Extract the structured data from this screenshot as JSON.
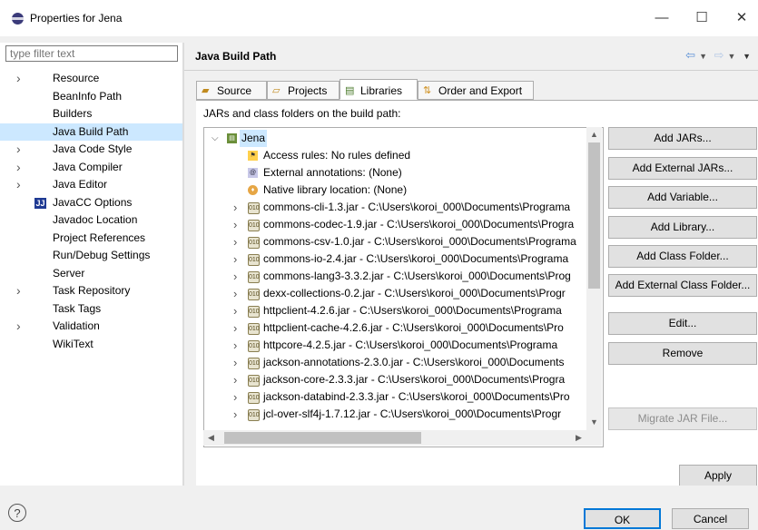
{
  "window": {
    "title": "Properties for Jena",
    "minimize": "—",
    "maximize": "☐",
    "close": "✕"
  },
  "filter": {
    "placeholder": "type filter text"
  },
  "nav_tree": [
    {
      "label": "Resource",
      "expandable": true
    },
    {
      "label": "BeanInfo Path",
      "expandable": false
    },
    {
      "label": "Builders",
      "expandable": false
    },
    {
      "label": "Java Build Path",
      "expandable": false,
      "selected": true
    },
    {
      "label": "Java Code Style",
      "expandable": true
    },
    {
      "label": "Java Compiler",
      "expandable": true
    },
    {
      "label": "Java Editor",
      "expandable": true
    },
    {
      "label": "JavaCC Options",
      "expandable": false,
      "icon": "jj"
    },
    {
      "label": "Javadoc Location",
      "expandable": false
    },
    {
      "label": "Project References",
      "expandable": false
    },
    {
      "label": "Run/Debug Settings",
      "expandable": false
    },
    {
      "label": "Server",
      "expandable": false
    },
    {
      "label": "Task Repository",
      "expandable": true
    },
    {
      "label": "Task Tags",
      "expandable": false
    },
    {
      "label": "Validation",
      "expandable": true
    },
    {
      "label": "WikiText",
      "expandable": false
    }
  ],
  "page": {
    "title": "Java Build Path",
    "nav_icons": [
      "back-arrow-icon",
      "dropdown-icon",
      "forward-arrow-icon",
      "dropdown-icon",
      "menu-icon"
    ]
  },
  "tabs": [
    {
      "label": "Source",
      "icon": "source-folder-icon",
      "active": false
    },
    {
      "label": "Projects",
      "icon": "projects-icon",
      "active": false
    },
    {
      "label": "Libraries",
      "icon": "libraries-icon",
      "active": true
    },
    {
      "label": "Order and Export",
      "icon": "order-export-icon",
      "active": false
    }
  ],
  "libraries": {
    "description": "JARs and class folders on the build path:",
    "root": "Jena",
    "root_children": [
      {
        "label": "Access rules: No rules defined",
        "icon": "access-rules-icon"
      },
      {
        "label": "External annotations: (None)",
        "icon": "external-annotations-icon"
      },
      {
        "label": "Native library location: (None)",
        "icon": "native-library-icon"
      }
    ],
    "jars": [
      "commons-cli-1.3.jar - C:\\Users\\koroi_000\\Documents\\Programa",
      "commons-codec-1.9.jar - C:\\Users\\koroi_000\\Documents\\Progra",
      "commons-csv-1.0.jar - C:\\Users\\koroi_000\\Documents\\Programa",
      "commons-io-2.4.jar - C:\\Users\\koroi_000\\Documents\\Programa",
      "commons-lang3-3.3.2.jar - C:\\Users\\koroi_000\\Documents\\Prog",
      "dexx-collections-0.2.jar - C:\\Users\\koroi_000\\Documents\\Progr",
      "httpclient-4.2.6.jar - C:\\Users\\koroi_000\\Documents\\Programa",
      "httpclient-cache-4.2.6.jar - C:\\Users\\koroi_000\\Documents\\Pro",
      "httpcore-4.2.5.jar - C:\\Users\\koroi_000\\Documents\\Programa",
      "jackson-annotations-2.3.0.jar - C:\\Users\\koroi_000\\Documents",
      "jackson-core-2.3.3.jar - C:\\Users\\koroi_000\\Documents\\Progra",
      "jackson-databind-2.3.3.jar - C:\\Users\\koroi_000\\Documents\\Pro",
      "jcl-over-slf4j-1.7.12.jar - C:\\Users\\koroi_000\\Documents\\Progr"
    ]
  },
  "side_buttons": [
    {
      "label": "Add JARs...",
      "enabled": true
    },
    {
      "label": "Add External JARs...",
      "enabled": true
    },
    {
      "label": "Add Variable...",
      "enabled": true
    },
    {
      "label": "Add Library...",
      "enabled": true
    },
    {
      "label": "Add Class Folder...",
      "enabled": true
    },
    {
      "label": "Add External Class Folder...",
      "enabled": true
    },
    {
      "label": "Edit...",
      "enabled": true
    },
    {
      "label": "Remove",
      "enabled": true
    },
    {
      "label": "Migrate JAR File...",
      "enabled": false
    }
  ],
  "buttons": {
    "apply": "Apply",
    "ok": "OK",
    "cancel": "Cancel",
    "help": "?"
  },
  "colors": {
    "selection": "#cce8ff",
    "accent": "#0078d7"
  }
}
